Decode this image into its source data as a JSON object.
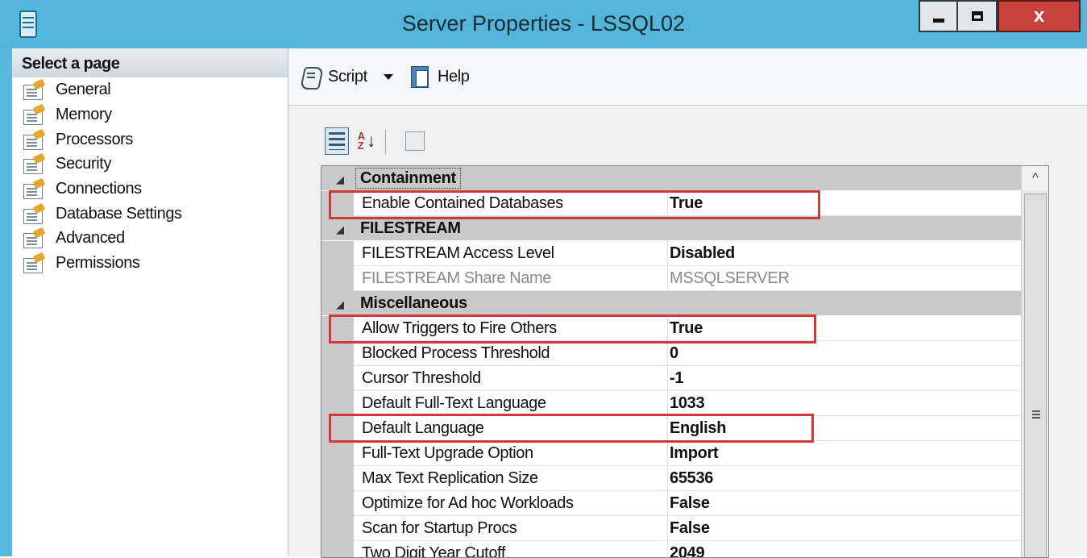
{
  "window": {
    "title": "Server Properties - LSSQL02",
    "close_glyph": "x"
  },
  "sidebar": {
    "header": "Select a page",
    "items": [
      {
        "label": "General",
        "icon": "page-wrench-icon"
      },
      {
        "label": "Memory",
        "icon": "page-wrench-icon"
      },
      {
        "label": "Processors",
        "icon": "page-wrench-icon"
      },
      {
        "label": "Security",
        "icon": "page-wrench-icon"
      },
      {
        "label": "Connections",
        "icon": "page-wrench-icon"
      },
      {
        "label": "Database Settings",
        "icon": "page-wrench-icon"
      },
      {
        "label": "Advanced",
        "icon": "page-wrench-icon"
      },
      {
        "label": "Permissions",
        "icon": "page-wrench-icon"
      }
    ]
  },
  "toolbar": {
    "script_label": "Script",
    "help_label": "Help"
  },
  "grid_toolbar": {
    "alpha_glyph": "A",
    "alpha_z": "Z",
    "sort_arrow": "↓"
  },
  "properties": {
    "categories": {
      "containment": {
        "label": "Containment",
        "collapse_glyph": "◢"
      },
      "filestream": {
        "label": "FILESTREAM",
        "collapse_glyph": "◢"
      },
      "misc": {
        "label": "Miscellaneous",
        "collapse_glyph": "◢"
      }
    },
    "rows": {
      "contained_db": {
        "name": "Enable Contained Databases",
        "value": "True"
      },
      "fs_access": {
        "name": "FILESTREAM Access Level",
        "value": "Disabled"
      },
      "fs_share": {
        "name": "FILESTREAM Share Name",
        "value": "MSSQLSERVER"
      },
      "triggers": {
        "name": "Allow Triggers to Fire Others",
        "value": "True"
      },
      "blocked": {
        "name": "Blocked Process Threshold",
        "value": "0"
      },
      "cursor": {
        "name": "Cursor Threshold",
        "value": "-1"
      },
      "ft_lang": {
        "name": "Default Full-Text Language",
        "value": "1033"
      },
      "def_lang": {
        "name": "Default Language",
        "value": "English"
      },
      "ft_upgrade": {
        "name": "Full-Text Upgrade Option",
        "value": "Import"
      },
      "max_repl": {
        "name": "Max Text Replication Size",
        "value": "65536"
      },
      "adhoc": {
        "name": "Optimize for Ad hoc Workloads",
        "value": "False"
      },
      "startup": {
        "name": "Scan for Startup Procs",
        "value": "False"
      },
      "two_digit": {
        "name": "Two Digit Year Cutoff",
        "value": "2049"
      }
    }
  },
  "scrollbar": {
    "up_glyph": "^"
  },
  "colors": {
    "titlebar": "#53b5da",
    "highlight": "#d0383b",
    "close_button": "#c7423b"
  }
}
